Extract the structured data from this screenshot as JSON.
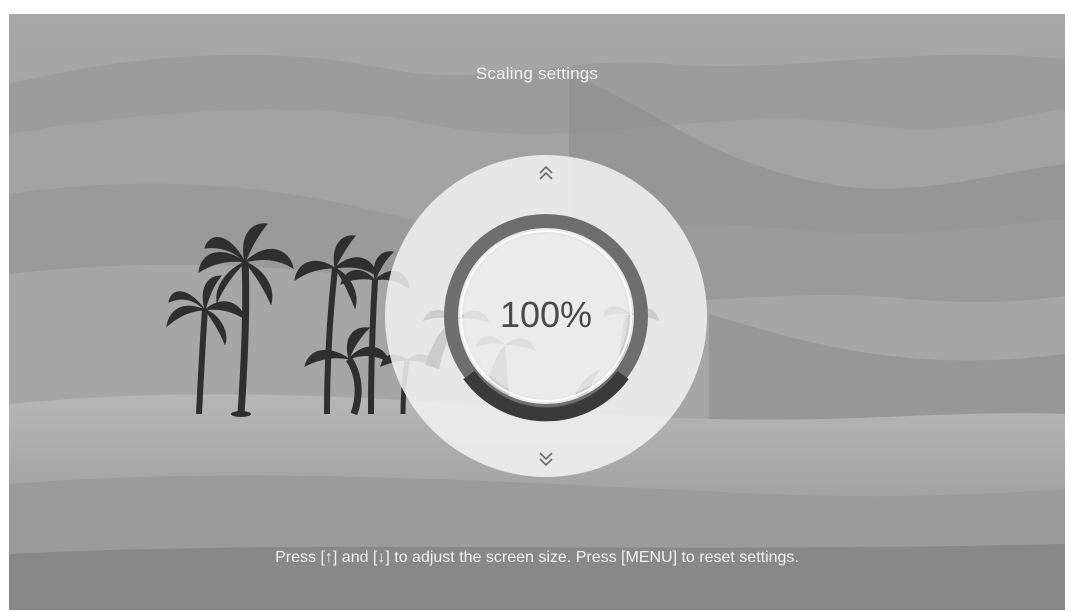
{
  "screen": {
    "title": "Scaling settings",
    "hint": "Press [↑] and [↓] to adjust the screen size. Press [MENU] to reset settings."
  },
  "scaling": {
    "value_label": "100%",
    "value_percent": 100
  },
  "icons": {
    "up": "chevron-double-up-icon",
    "down": "chevron-double-down-icon"
  },
  "colors": {
    "text_light": "#f2f2f2",
    "dial_face": "#f2f2f2",
    "ring": "#6e6e6e",
    "value_text": "#4a4a4a"
  }
}
